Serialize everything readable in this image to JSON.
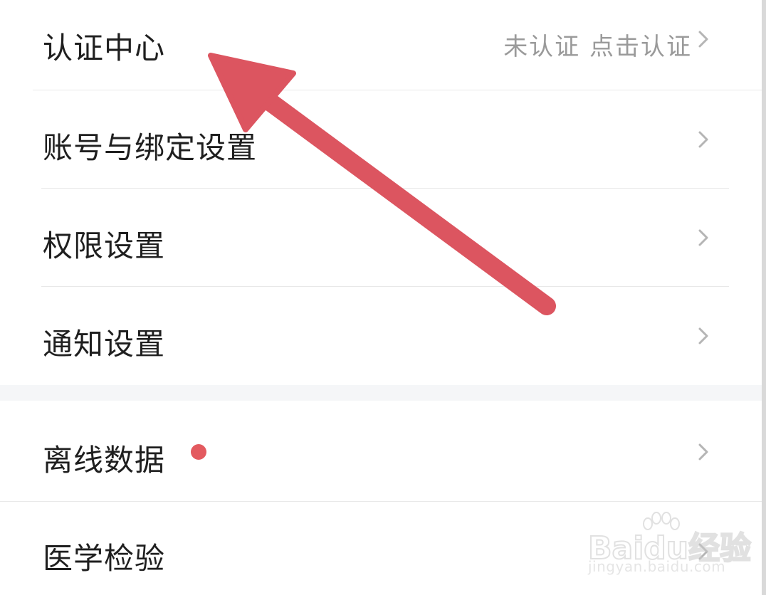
{
  "settings": {
    "rows": [
      {
        "label": "认证中心",
        "status": "未认证 点击认证",
        "icon": "chevron-right-icon"
      },
      {
        "label": "账号与绑定设置",
        "status": "",
        "icon": "chevron-right-icon"
      },
      {
        "label": "权限设置",
        "status": "",
        "icon": "chevron-right-icon"
      },
      {
        "label": "通知设置",
        "status": "",
        "icon": "chevron-right-icon"
      },
      {
        "label": "离线数据",
        "status": "",
        "icon": "chevron-right-icon",
        "badge": "red-dot"
      },
      {
        "label": "医学检验",
        "status": "",
        "icon": "chevron-right-icon"
      }
    ]
  },
  "annotation": {
    "arrow_color": "#dc5560",
    "arrow_icon": "red-arrow-icon"
  },
  "watermark": {
    "brand": "Baidu经验",
    "url": "jingyan.baidu.com"
  },
  "colors": {
    "text_primary": "#1f1f1f",
    "text_secondary": "#9a9a9a",
    "chevron": "#b5b5b5",
    "badge": "#e35a5f",
    "section_gap": "#f5f6f8"
  }
}
